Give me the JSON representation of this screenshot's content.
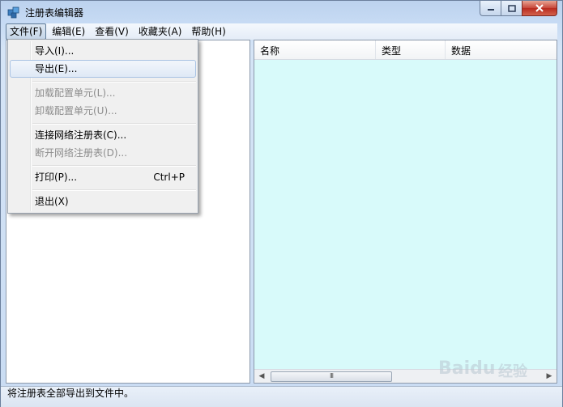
{
  "window": {
    "title": "注册表编辑器"
  },
  "menubar": {
    "items": [
      {
        "label": "文件(F)",
        "active": true
      },
      {
        "label": "编辑(E)"
      },
      {
        "label": "查看(V)"
      },
      {
        "label": "收藏夹(A)"
      },
      {
        "label": "帮助(H)"
      }
    ]
  },
  "file_menu": {
    "items": [
      {
        "label": "导入(I)...",
        "enabled": true
      },
      {
        "label": "导出(E)...",
        "enabled": true,
        "highlighted": true
      },
      {
        "label": "加载配置单元(L)...",
        "enabled": false
      },
      {
        "label": "卸载配置单元(U)...",
        "enabled": false
      },
      {
        "label": "连接网络注册表(C)...",
        "enabled": true
      },
      {
        "label": "断开网络注册表(D)...",
        "enabled": false
      },
      {
        "label": "打印(P)...",
        "shortcut": "Ctrl+P",
        "enabled": true
      },
      {
        "label": "退出(X)",
        "enabled": true
      }
    ]
  },
  "list_view": {
    "columns": [
      "名称",
      "类型",
      "数据"
    ],
    "background": "#d8fafa",
    "scroll_thumb_glyph": "III"
  },
  "statusbar": {
    "text": "将注册表全部导出到文件中。"
  },
  "watermark": {
    "latin": "Baidu",
    "cn": "经验"
  }
}
